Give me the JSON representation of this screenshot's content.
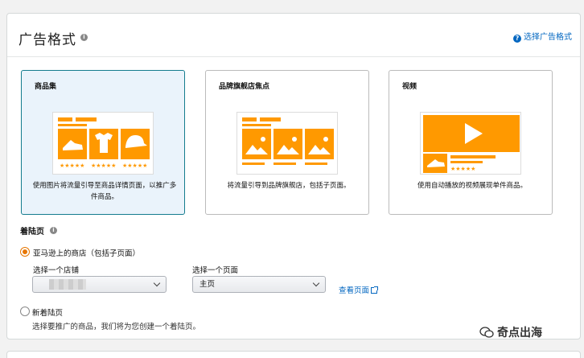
{
  "header": {
    "title": "广告格式",
    "help_link": "选择广告格式"
  },
  "cards": [
    {
      "title": "商品集",
      "description": "使用图片将流量引导至商品详情页面，以推广多件商品。",
      "selected": true
    },
    {
      "title": "品牌旗舰店焦点",
      "description": "将流量引导到品牌旗舰店，包括子页面。",
      "selected": false
    },
    {
      "title": "视频",
      "description": "使用自动播放的视频展现单件商品。",
      "selected": false
    }
  ],
  "landing": {
    "title": "着陆页",
    "option_store": "亚马逊上的商店（包括子页面）",
    "store_label": "选择一个店铺",
    "page_label": "选择一个页面",
    "page_value": "主页",
    "view_page": "查看页面",
    "option_new": "新着陆页",
    "new_note": "选择要推广的商品，我们将为您创建一个着陆页。"
  },
  "colors": {
    "accent": "#ff9900",
    "selected_border": "#147c8e",
    "link": "#0066c0",
    "radio": "#e77600"
  },
  "watermark": "奇点出海"
}
